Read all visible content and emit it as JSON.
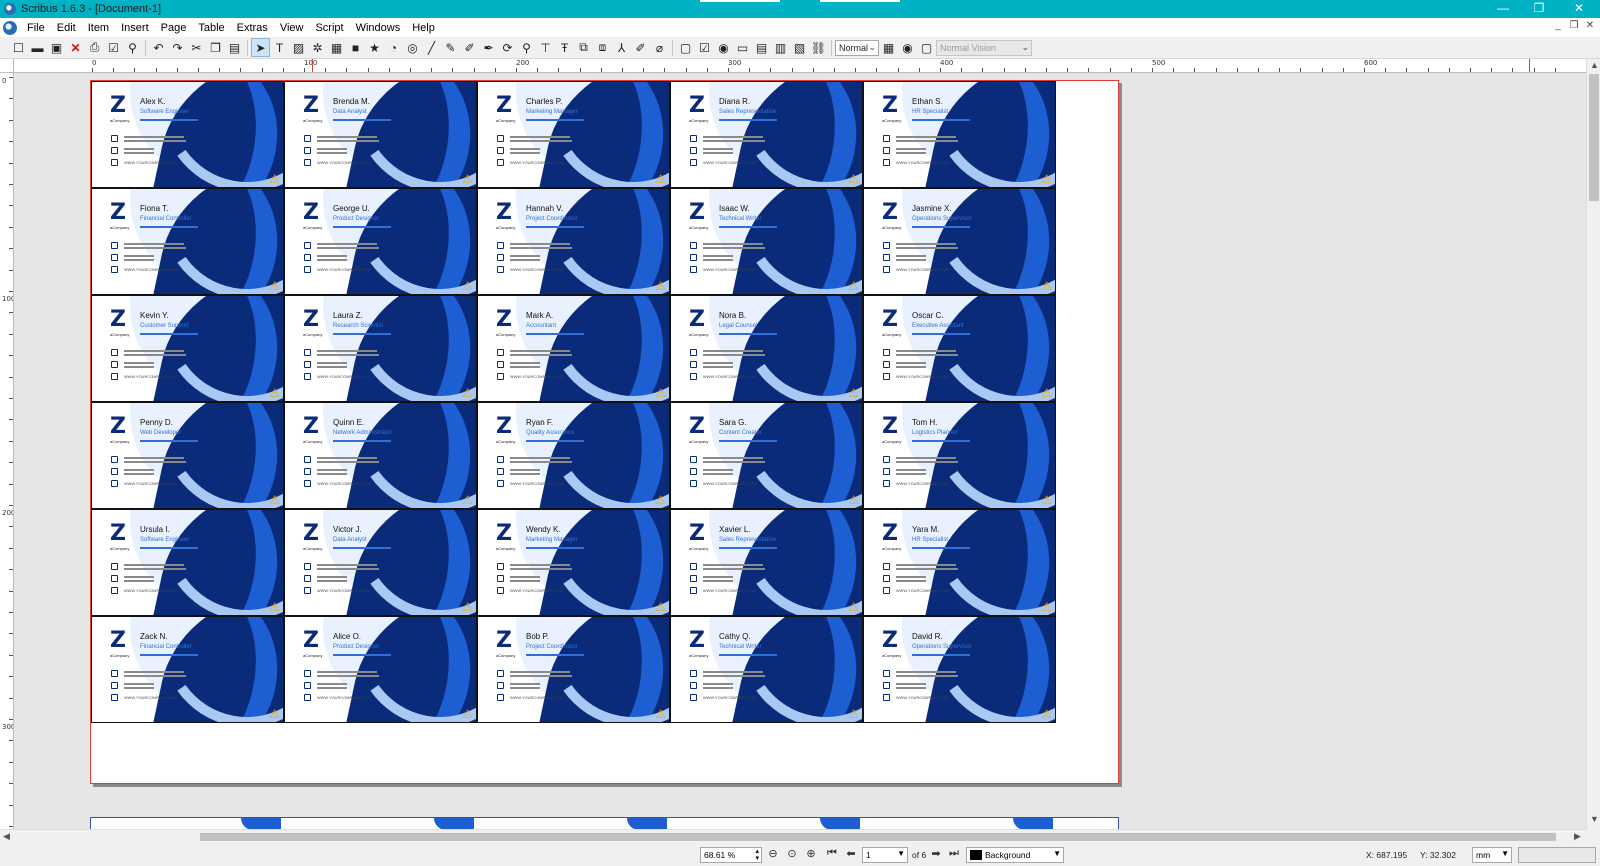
{
  "window": {
    "title": "Scribus 1.6.3 - [Document-1]",
    "minimize": "—",
    "restore": "❐",
    "close": "✕"
  },
  "menubar": {
    "items": [
      "File",
      "Edit",
      "Item",
      "Insert",
      "Page",
      "Table",
      "Extras",
      "View",
      "Script",
      "Windows",
      "Help"
    ],
    "mdi_minimize": "_",
    "mdi_restore": "❐",
    "mdi_close": "✕"
  },
  "toolbar": {
    "view_mode": "Normal",
    "vision": "Normal Vision"
  },
  "rulers": {
    "horizontal_labels": [
      "0",
      "100",
      "200",
      "300",
      "400",
      "500",
      "600"
    ],
    "vertical_labels": [
      "0",
      "100",
      "200",
      "300"
    ]
  },
  "cards": [
    {
      "name": "Alex K.",
      "role": "Software Engineer"
    },
    {
      "name": "Brenda M.",
      "role": "Data Analyst"
    },
    {
      "name": "Charles P.",
      "role": "Marketing Manager"
    },
    {
      "name": "Diana R.",
      "role": "Sales Representative"
    },
    {
      "name": "Ethan S.",
      "role": "HR Specialist"
    },
    {
      "name": "Fiona T.",
      "role": "Financial Controller"
    },
    {
      "name": "George U.",
      "role": "Product Designer"
    },
    {
      "name": "Hannah V.",
      "role": "Project Coordinator"
    },
    {
      "name": "Isaac W.",
      "role": "Technical Writer"
    },
    {
      "name": "Jasmine X.",
      "role": "Operations Supervisor"
    },
    {
      "name": "Kevin Y.",
      "role": "Customer Support"
    },
    {
      "name": "Laura Z.",
      "role": "Research Scientist"
    },
    {
      "name": "Mark A.",
      "role": "Accountant"
    },
    {
      "name": "Nora B.",
      "role": "Legal Counsel"
    },
    {
      "name": "Oscar C.",
      "role": "Executive Assistant"
    },
    {
      "name": "Penny D.",
      "role": "Web Developer"
    },
    {
      "name": "Quinn E.",
      "role": "Network Administrator"
    },
    {
      "name": "Ryan F.",
      "role": "Quality Assurance"
    },
    {
      "name": "Sara G.",
      "role": "Content Creator"
    },
    {
      "name": "Tom H.",
      "role": "Logistics Planner"
    },
    {
      "name": "Ursula I.",
      "role": "Software Engineer"
    },
    {
      "name": "Victor J.",
      "role": "Data Analyst"
    },
    {
      "name": "Wendy K.",
      "role": "Marketing Manager"
    },
    {
      "name": "Xavier L.",
      "role": "Sales Representative"
    },
    {
      "name": "Yara M.",
      "role": "HR Specialist"
    },
    {
      "name": "Zack N.",
      "role": "Financial Controller"
    },
    {
      "name": "Alice O.",
      "role": "Product Designer"
    },
    {
      "name": "Bob P.",
      "role": "Project Coordinator"
    },
    {
      "name": "Cathy Q.",
      "role": "Technical Writer"
    },
    {
      "name": "David R.",
      "role": "Operations Supervisor"
    }
  ],
  "card_template": {
    "company": "aCompany",
    "website": "WWW.YOURCOMPANY.COM",
    "colors": {
      "navy": "#0a2a7a",
      "blue": "#1d5fd3",
      "light_blue": "#a9c8f4",
      "warning": "#f2a900"
    }
  },
  "statusbar": {
    "zoom": "68.61 %",
    "page_number": "1",
    "page_count": "of 6",
    "layer": "Background",
    "x_coord": "X: 687.195",
    "y_coord": "Y: 32.302",
    "unit": "mm"
  }
}
